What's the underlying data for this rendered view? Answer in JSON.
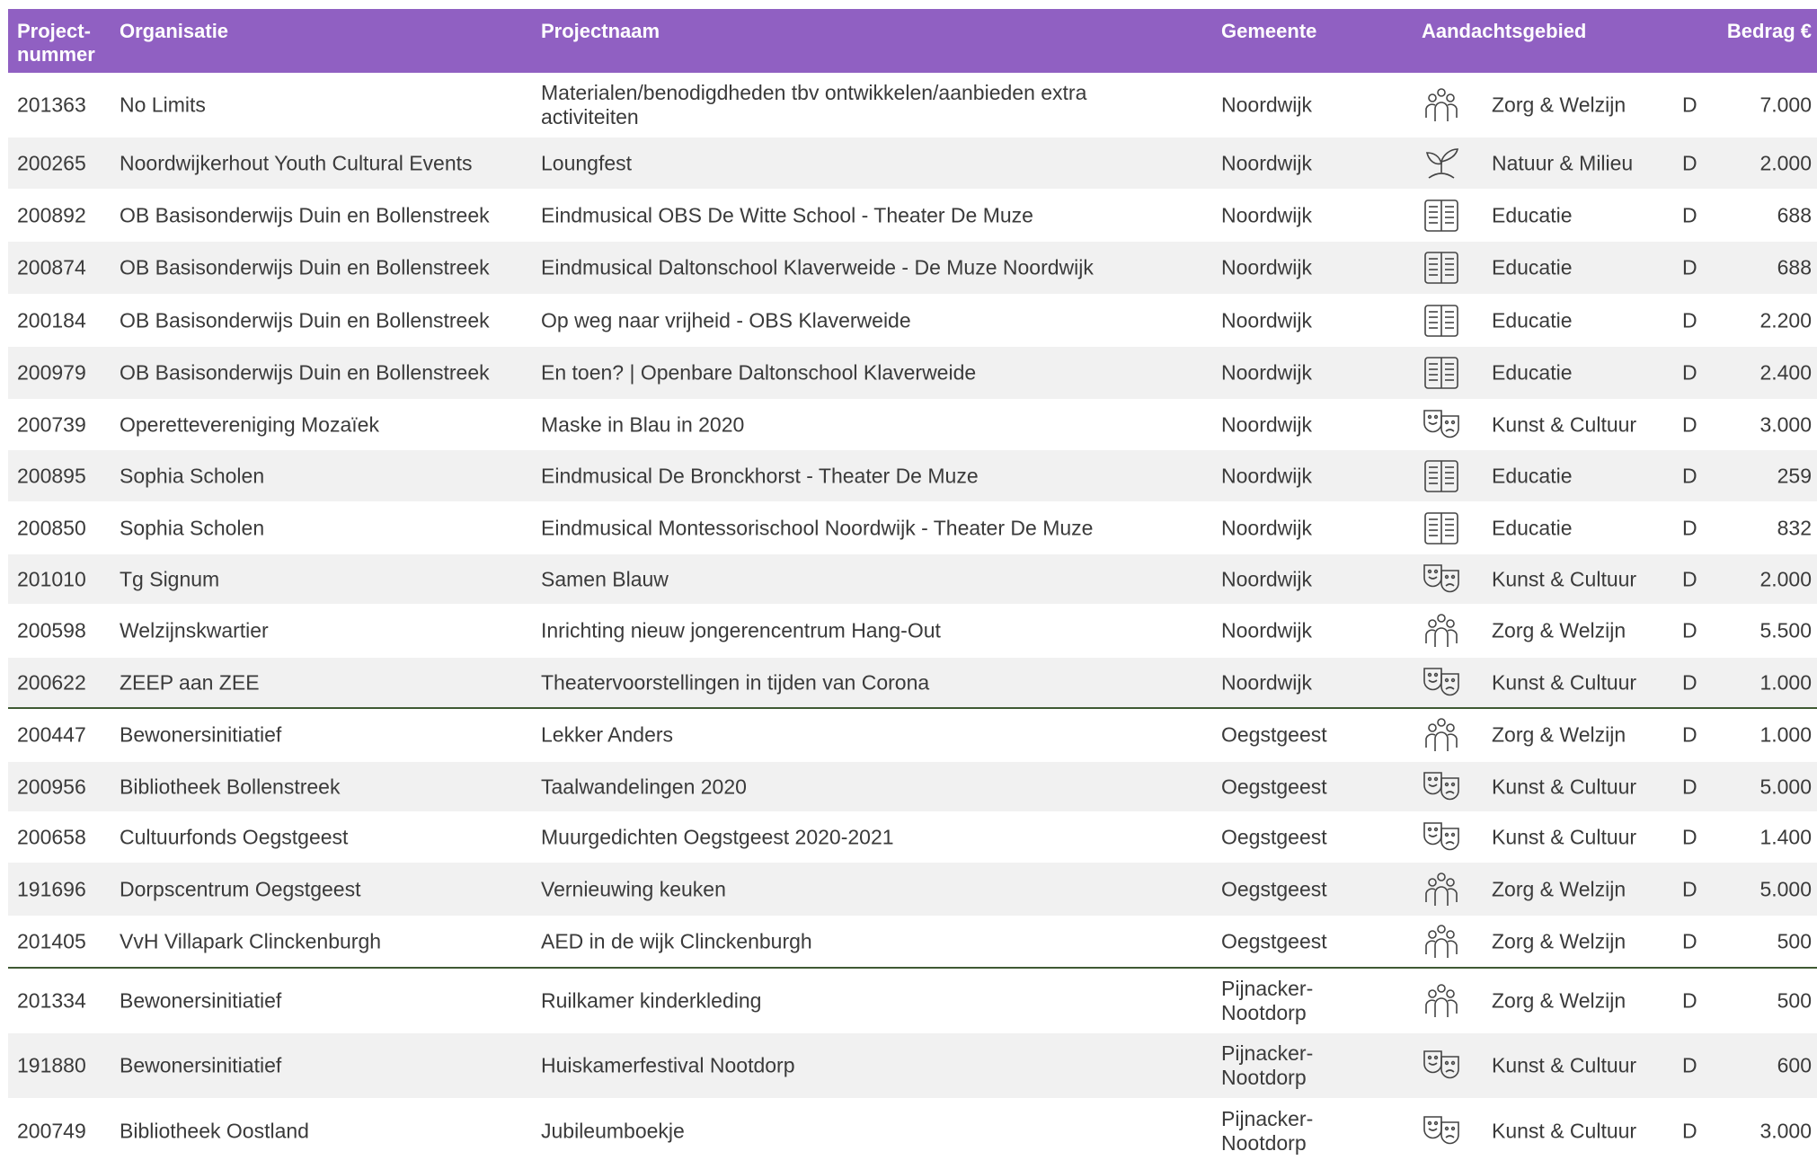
{
  "header": {
    "num": "Project-\nnummer",
    "org": "Organisatie",
    "proj": "Projectnaam",
    "gem": "Gemeente",
    "area": "Aandachtsgebied",
    "amt": "Bedrag €"
  },
  "rows": [
    {
      "num": "201363",
      "org": "No Limits",
      "proj": "Materialen/benodigdheden tbv ontwikkelen/aanbieden extra activiteiten",
      "gem": "Noordwijk",
      "icon": "people-icon",
      "area": "Zorg & Welzijn",
      "d": "D",
      "amt": "7.000"
    },
    {
      "num": "200265",
      "org": "Noordwijkerhout Youth Cultural Events",
      "proj": "Loungfest",
      "gem": "Noordwijk",
      "icon": "plant-icon",
      "area": "Natuur & Milieu",
      "d": "D",
      "amt": "2.000"
    },
    {
      "num": "200892",
      "org": "OB Basisonderwijs Duin en Bollenstreek",
      "proj": "Eindmusical OBS De Witte School - Theater De Muze",
      "gem": "Noordwijk",
      "icon": "book-icon",
      "area": "Educatie",
      "d": "D",
      "amt": "688"
    },
    {
      "num": "200874",
      "org": "OB Basisonderwijs Duin en Bollenstreek",
      "proj": "Eindmusical Daltonschool Klaverweide - De Muze Noordwijk",
      "gem": "Noordwijk",
      "icon": "book-icon",
      "area": "Educatie",
      "d": "D",
      "amt": "688"
    },
    {
      "num": "200184",
      "org": "OB Basisonderwijs Duin en Bollenstreek",
      "proj": "Op weg naar vrijheid - OBS Klaverweide",
      "gem": "Noordwijk",
      "icon": "book-icon",
      "area": "Educatie",
      "d": "D",
      "amt": "2.200"
    },
    {
      "num": "200979",
      "org": "OB Basisonderwijs Duin en Bollenstreek",
      "proj": "En toen? | Openbare Daltonschool Klaverweide",
      "gem": "Noordwijk",
      "icon": "book-icon",
      "area": "Educatie",
      "d": "D",
      "amt": "2.400"
    },
    {
      "num": "200739",
      "org": "Operettevereniging Mozaïek",
      "proj": "Maske in Blau in 2020",
      "gem": "Noordwijk",
      "icon": "theater-masks-icon",
      "area": "Kunst & Cultuur",
      "d": "D",
      "amt": "3.000"
    },
    {
      "num": "200895",
      "org": "Sophia Scholen",
      "proj": "Eindmusical De Bronckhorst - Theater De Muze",
      "gem": "Noordwijk",
      "icon": "book-icon",
      "area": "Educatie",
      "d": "D",
      "amt": "259"
    },
    {
      "num": "200850",
      "org": "Sophia Scholen",
      "proj": "Eindmusical Montessorischool Noordwijk - Theater De Muze",
      "gem": "Noordwijk",
      "icon": "book-icon",
      "area": "Educatie",
      "d": "D",
      "amt": "832"
    },
    {
      "num": "201010",
      "org": "Tg Signum",
      "proj": "Samen Blauw",
      "gem": "Noordwijk",
      "icon": "theater-masks-icon",
      "area": "Kunst & Cultuur",
      "d": "D",
      "amt": "2.000"
    },
    {
      "num": "200598",
      "org": "Welzijnskwartier",
      "proj": "Inrichting nieuw jongerencentrum Hang-Out",
      "gem": "Noordwijk",
      "icon": "people-icon",
      "area": "Zorg & Welzijn",
      "d": "D",
      "amt": "5.500"
    },
    {
      "num": "200622",
      "org": "ZEEP aan ZEE",
      "proj": "Theatervoorstellingen in tijden van Corona",
      "gem": "Noordwijk",
      "icon": "theater-masks-icon",
      "area": "Kunst & Cultuur",
      "d": "D",
      "amt": "1.000"
    },
    {
      "num": "200447",
      "org": "Bewonersinitiatief",
      "proj": "Lekker Anders",
      "gem": "Oegstgeest",
      "icon": "people-icon",
      "area": "Zorg & Welzijn",
      "d": "D",
      "amt": "1.000"
    },
    {
      "num": "200956",
      "org": "Bibliotheek Bollenstreek",
      "proj": "Taalwandelingen 2020",
      "gem": "Oegstgeest",
      "icon": "theater-masks-icon",
      "area": "Kunst & Cultuur",
      "d": "D",
      "amt": "5.000"
    },
    {
      "num": "200658",
      "org": "Cultuurfonds Oegstgeest",
      "proj": "Muurgedichten Oegstgeest 2020-2021",
      "gem": "Oegstgeest",
      "icon": "theater-masks-icon",
      "area": "Kunst & Cultuur",
      "d": "D",
      "amt": "1.400"
    },
    {
      "num": "191696",
      "org": "Dorpscentrum Oegstgeest",
      "proj": "Vernieuwing keuken",
      "gem": "Oegstgeest",
      "icon": "people-icon",
      "area": "Zorg & Welzijn",
      "d": "D",
      "amt": "5.000"
    },
    {
      "num": "201405",
      "org": "VvH Villapark Clinckenburgh",
      "proj": "AED in de wijk Clinckenburgh",
      "gem": "Oegstgeest",
      "icon": "people-icon",
      "area": "Zorg & Welzijn",
      "d": "D",
      "amt": "500"
    },
    {
      "num": "201334",
      "org": "Bewonersinitiatief",
      "proj": "Ruilkamer kinderkleding",
      "gem": "Pijnacker-Nootdorp",
      "icon": "people-icon",
      "area": "Zorg & Welzijn",
      "d": "D",
      "amt": "500"
    },
    {
      "num": "191880",
      "org": "Bewonersinitiatief",
      "proj": "Huiskamerfestival Nootdorp",
      "gem": "Pijnacker-Nootdorp",
      "icon": "theater-masks-icon",
      "area": "Kunst & Cultuur",
      "d": "D",
      "amt": "600"
    },
    {
      "num": "200749",
      "org": "Bibliotheek Oostland",
      "proj": "Jubileumboekje",
      "gem": "Pijnacker-Nootdorp",
      "icon": "theater-masks-icon",
      "area": "Kunst & Cultuur",
      "d": "D",
      "amt": "3.000"
    }
  ],
  "colors": {
    "header": "#9060c2",
    "stripe": "#f1f1f1",
    "separator": "#3f5a33"
  }
}
